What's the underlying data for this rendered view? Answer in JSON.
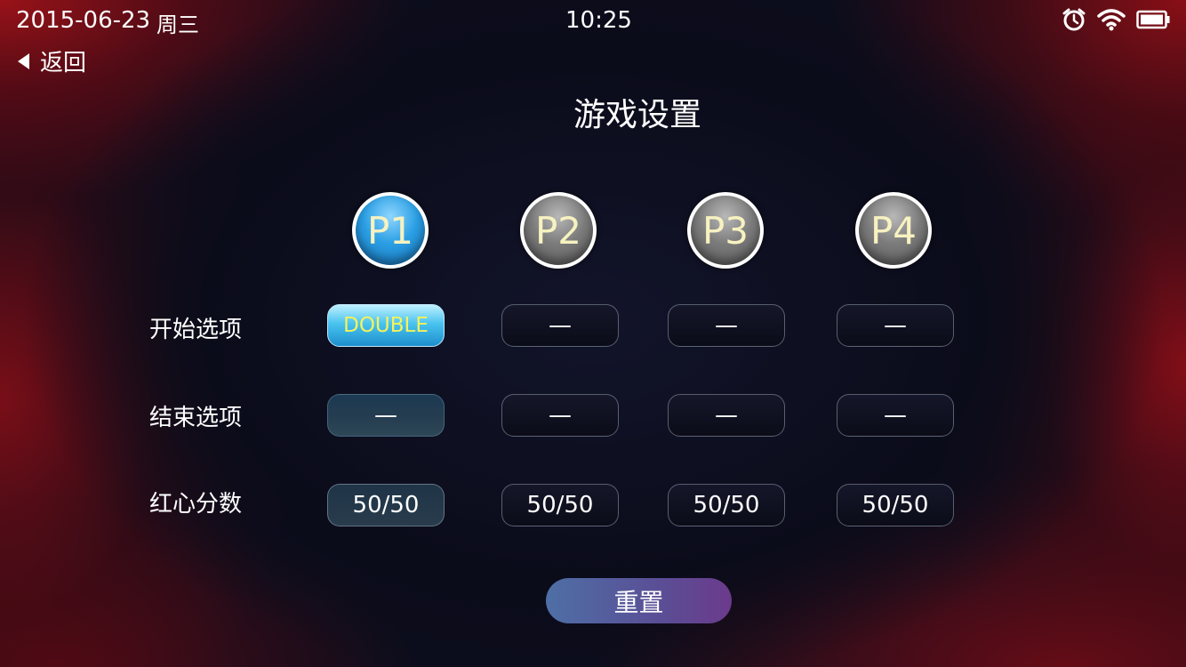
{
  "status_bar": {
    "date": "2015-06-23",
    "weekday": "周三",
    "time": "10:25",
    "icons": [
      "alarm-icon",
      "wifi-icon",
      "battery-icon"
    ]
  },
  "nav": {
    "back_label": "返回"
  },
  "title": "游戏设置",
  "players": [
    {
      "label": "P1",
      "selected": true
    },
    {
      "label": "P2",
      "selected": false
    },
    {
      "label": "P3",
      "selected": false
    },
    {
      "label": "P4",
      "selected": false
    }
  ],
  "rows": {
    "start_option": {
      "label": "开始选项",
      "values": [
        "DOUBLE",
        "—",
        "—",
        "—"
      ]
    },
    "end_option": {
      "label": "结束选项",
      "values": [
        "—",
        "—",
        "—",
        "—"
      ]
    },
    "bullseye_score": {
      "label": "红心分数",
      "values": [
        "50/50",
        "50/50",
        "50/50",
        "50/50"
      ]
    }
  },
  "reset_label": "重置",
  "colors": {
    "accent_blue": "#2b9fe4",
    "highlight_text": "#f6f25a",
    "reset_gradient_start": "#4e6fa6",
    "reset_gradient_end": "#6b3a8c"
  }
}
